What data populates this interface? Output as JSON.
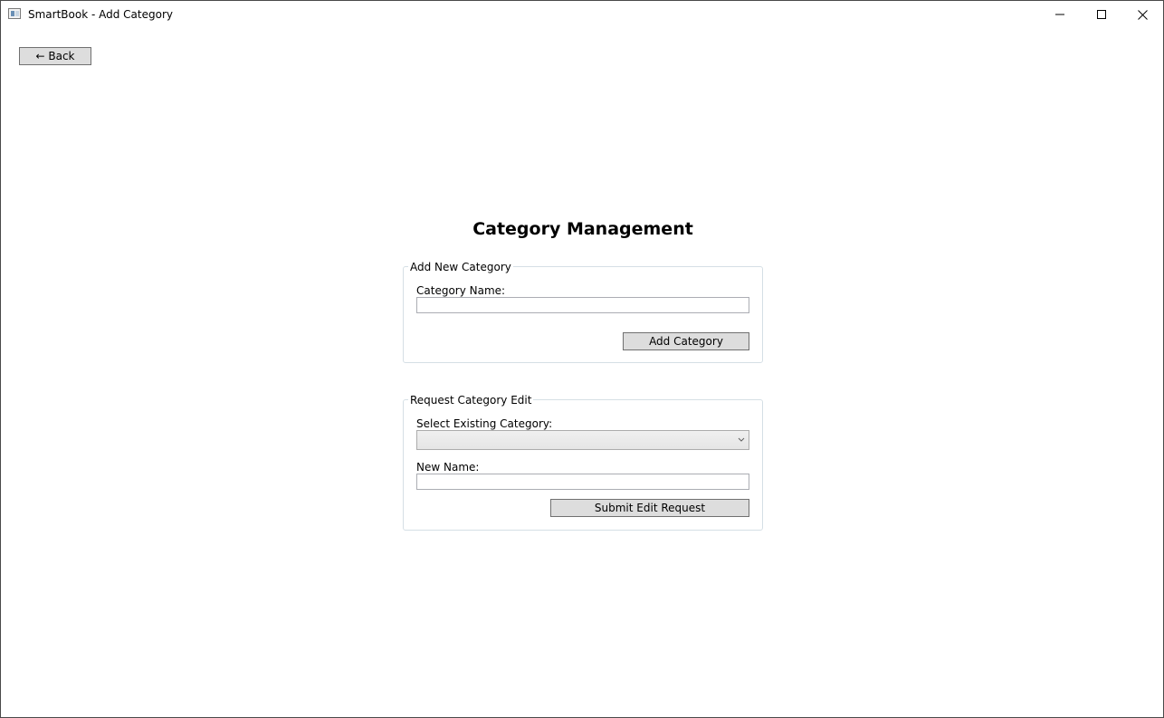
{
  "window": {
    "title": "SmartBook - Add Category",
    "icon": "app-window-icon",
    "controls": {
      "minimize_icon": "minimize-icon",
      "maximize_icon": "maximize-icon",
      "close_icon": "close-icon"
    }
  },
  "toolbar": {
    "back_label": "← Back"
  },
  "main": {
    "title": "Category Management"
  },
  "add_group": {
    "header": "Add New Category",
    "name_label": "Category Name:",
    "name_value": "",
    "submit_label": "Add Category"
  },
  "edit_group": {
    "header": "Request Category Edit",
    "select_label": "Select Existing Category:",
    "select_value": "",
    "new_name_label": "New Name:",
    "new_name_value": "",
    "submit_label": "Submit Edit Request"
  },
  "colors": {
    "window_border": "#4a4a4a",
    "button_face": "#dddddd",
    "button_border": "#707070",
    "groupbox_border": "#d5dfe5",
    "textbox_border": "#abadb3"
  }
}
